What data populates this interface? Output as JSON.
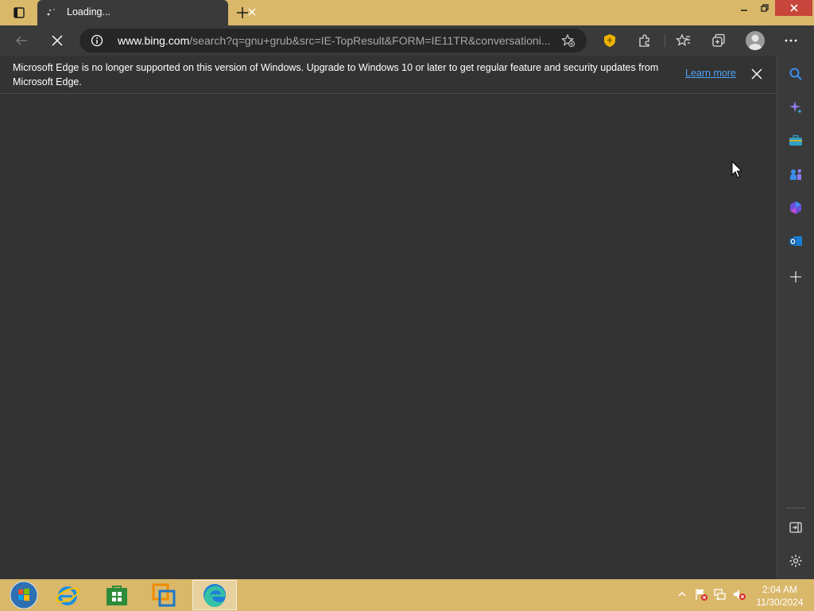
{
  "browser": {
    "tab": {
      "title": "Loading..."
    },
    "address": {
      "host": "www.bing.com",
      "path": "/search?q=gnu+grub&src=IE-TopResult&FORM=IE11TR&conversationi..."
    },
    "icons": [
      "tab-actions-icon",
      "loading-spinner-icon",
      "close-icon",
      "plus-icon",
      "back-arrow-icon",
      "stop-icon",
      "info-icon",
      "add-favorite-icon",
      "shield-extension-icon",
      "extensions-icon",
      "favorites-icon",
      "collections-icon",
      "profile-avatar",
      "more-icon"
    ]
  },
  "infobar": {
    "message": "Microsoft Edge is no longer supported on this version of Windows. Upgrade to Windows 10 or later to get regular feature and security updates from Microsoft Edge.",
    "link": "Learn more"
  },
  "sidebar": {
    "items": [
      "search-icon",
      "copilot-icon",
      "tools-icon",
      "games-icon",
      "microsoft-365-icon",
      "outlook-icon",
      "add-icon",
      "hide-sidebar-icon",
      "settings-icon"
    ]
  },
  "taskbar": {
    "apps": [
      "start-orb",
      "internet-explorer-icon",
      "store-icon",
      "vmware-icon",
      "edge-icon"
    ],
    "clock": {
      "time": "2:04 AM",
      "date": "11/30/2024"
    }
  },
  "colors": {
    "chrome": "#3a3a3a",
    "content": "#333333",
    "wallpaper": "#d9b86a",
    "close": "#c7453a",
    "link": "#4ea3f5"
  }
}
